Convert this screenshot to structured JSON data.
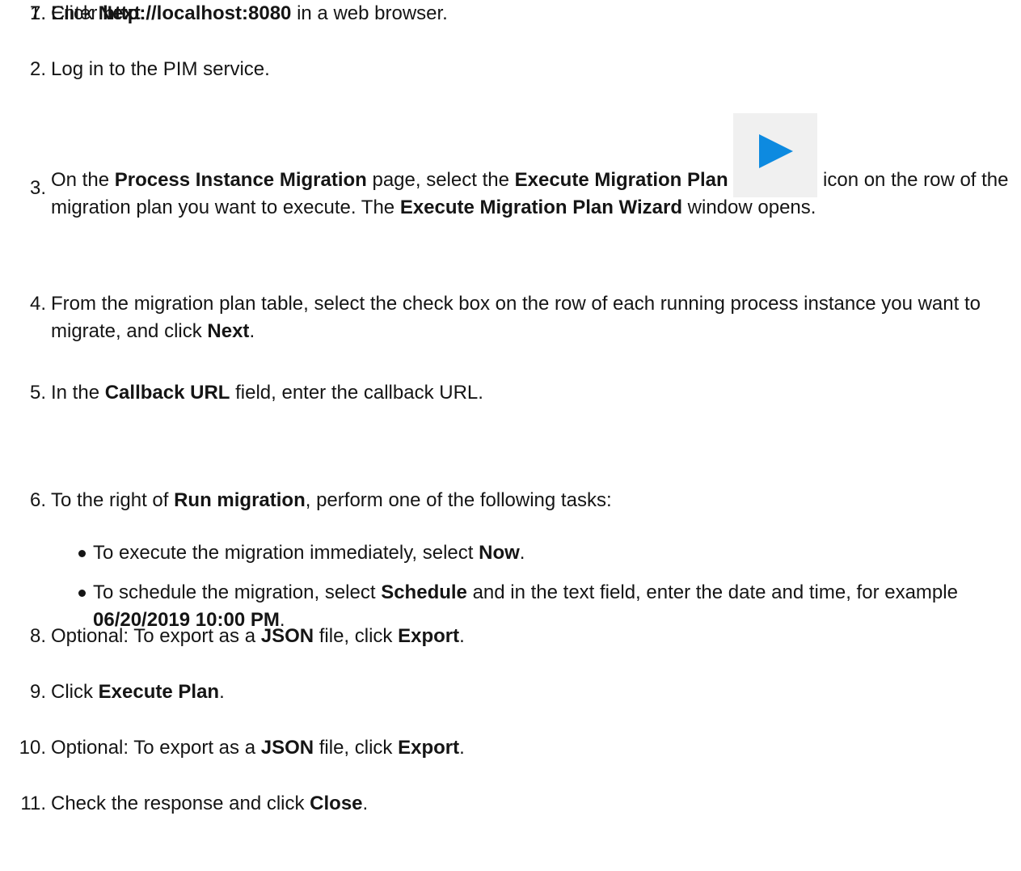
{
  "steps": [
    {
      "num": "1.",
      "segments": [
        {
          "t": "Enter "
        },
        {
          "t": "http://localhost:8080",
          "s": "mono"
        },
        {
          "t": " in a web browser."
        }
      ]
    },
    {
      "num": "2.",
      "segments": [
        {
          "t": "Log in to the PIM service."
        }
      ]
    },
    {
      "num": "3.",
      "segments": [
        {
          "t": "On the "
        },
        {
          "t": "Process Instance Migration",
          "s": "ui"
        },
        {
          "t": " page, select the "
        },
        {
          "t": "Execute Migration Plan",
          "s": "ui"
        },
        {
          "t": " "
        },
        {
          "icon": "play-icon"
        },
        {
          "t": " icon on the row of the migration plan you want to execute. The "
        },
        {
          "t": "Execute Migration Plan Wizard",
          "s": "ui"
        },
        {
          "t": " window opens."
        }
      ]
    },
    {
      "num": "4.",
      "segments": [
        {
          "t": "From the migration plan table, select the check box on the row of each running process instance you want to migrate, and click "
        },
        {
          "t": "Next",
          "s": "ui"
        },
        {
          "t": "."
        }
      ]
    },
    {
      "num": "5.",
      "segments": [
        {
          "t": "In the "
        },
        {
          "t": "Callback URL",
          "s": "ui"
        },
        {
          "t": " field, enter the callback URL."
        }
      ]
    },
    {
      "num": "6.",
      "segments": [
        {
          "t": "To the right of "
        },
        {
          "t": "Run migration",
          "s": "ui"
        },
        {
          "t": ", perform one of the following tasks:"
        }
      ],
      "subitems": [
        {
          "segments": [
            {
              "t": "To execute the migration immediately, select "
            },
            {
              "t": "Now",
              "s": "ui"
            },
            {
              "t": "."
            }
          ]
        },
        {
          "segments": [
            {
              "t": "To schedule the migration, select "
            },
            {
              "t": "Schedule",
              "s": "ui"
            },
            {
              "t": " and in the text field, enter the date and time, for example "
            },
            {
              "t": "06/20/2019 10:00 PM",
              "s": "mono"
            },
            {
              "t": "."
            }
          ]
        }
      ]
    },
    {
      "num": "7.",
      "segments": [
        {
          "t": "Click "
        },
        {
          "t": "Next",
          "s": "ui"
        },
        {
          "t": "."
        }
      ]
    },
    {
      "num": "8.",
      "segments": [
        {
          "t": "Optional: To export as a "
        },
        {
          "t": "JSON",
          "s": "mono"
        },
        {
          "t": " file, click "
        },
        {
          "t": "Export",
          "s": "ui"
        },
        {
          "t": "."
        }
      ]
    },
    {
      "num": "9.",
      "segments": [
        {
          "t": "Click "
        },
        {
          "t": "Execute Plan",
          "s": "ui"
        },
        {
          "t": "."
        }
      ]
    },
    {
      "num": "10.",
      "segments": [
        {
          "t": "Optional: To export as a "
        },
        {
          "t": "JSON",
          "s": "mono"
        },
        {
          "t": " file, click "
        },
        {
          "t": "Export",
          "s": "ui"
        },
        {
          "t": "."
        }
      ]
    },
    {
      "num": "11.",
      "segments": [
        {
          "t": "Check the response and click "
        },
        {
          "t": "Close",
          "s": "ui"
        },
        {
          "t": "."
        }
      ]
    }
  ],
  "colors": {
    "text": "#151515",
    "icon_bg": "#f0f0f0",
    "play": "#0d8ae0"
  }
}
